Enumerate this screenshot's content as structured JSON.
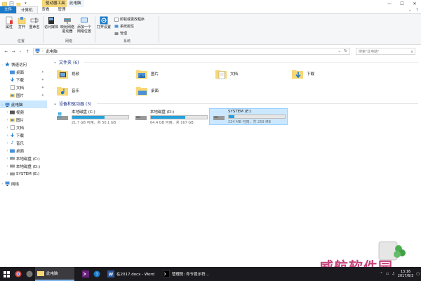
{
  "title_bar": {
    "context_tab": "驱动器工具",
    "window_title": "此电脑",
    "controls": [
      "—",
      "☐",
      "✕"
    ]
  },
  "tabs": {
    "file": "文件",
    "computer": "计算机",
    "view": "查看",
    "manage": "管理"
  },
  "ribbon": {
    "location": {
      "label": "位置",
      "properties": "属性",
      "open": "打开",
      "rename": "重命名"
    },
    "network": {
      "label": "网络",
      "access_media": "访问媒体",
      "map_drive": "映射网络驱动器",
      "add_location": "添加一个网络位置"
    },
    "system": {
      "label": "系统",
      "open_settings": "打开设置",
      "uninstall": "卸载或更改程序",
      "properties": "系统属性",
      "manage": "管理"
    }
  },
  "address": {
    "path": "此电脑",
    "search_placeholder": "搜索\"此电脑\""
  },
  "nav": {
    "quick_access": "快速访问",
    "quick_items": [
      {
        "label": "桌面"
      },
      {
        "label": "下载"
      },
      {
        "label": "文档"
      },
      {
        "label": "图片"
      }
    ],
    "this_pc": "此电脑",
    "pc_items": [
      {
        "label": "视频"
      },
      {
        "label": "图片"
      },
      {
        "label": "文档"
      },
      {
        "label": "下载"
      },
      {
        "label": "音乐"
      },
      {
        "label": "桌面"
      },
      {
        "label": "本地磁盘 (C:)"
      },
      {
        "label": "本地磁盘 (D:)"
      },
      {
        "label": "SYSTEM (E:)"
      }
    ],
    "network": "网络"
  },
  "content": {
    "folders_header": "文件夹 (6)",
    "folders": [
      {
        "label": "视频"
      },
      {
        "label": "图片"
      },
      {
        "label": "文档"
      },
      {
        "label": "下载"
      },
      {
        "label": "音乐"
      },
      {
        "label": "桌面"
      }
    ],
    "drives_header": "设备和驱动器 (3)",
    "drives": [
      {
        "label": "本地磁盘 (C:)",
        "size": "21.7 GB 可用，共 50.1 GB",
        "used_fraction": 0.57
      },
      {
        "label": "本地磁盘 (D:)",
        "size": "64.4 GB 可用，共 167 GB",
        "used_fraction": 0.61
      },
      {
        "label": "SYSTEM (E:)",
        "size": "234 MB 可用，共 259 MB",
        "used_fraction": 0.1
      }
    ]
  },
  "taskbar": {
    "items": [
      {
        "label": "此电脑"
      },
      {
        "label": "在2017.docx - Word"
      },
      {
        "label": "管理员: 命令提示符..."
      }
    ],
    "time": "13:16",
    "date": "2017/6/3"
  },
  "watermark": "威航软件园",
  "colors": {
    "accent": "#1979ca",
    "selection": "#cce8ff",
    "drive_fill": "#26a0da",
    "folder_yellow": "#f8d775",
    "taskbar": "#1b1b1f"
  }
}
